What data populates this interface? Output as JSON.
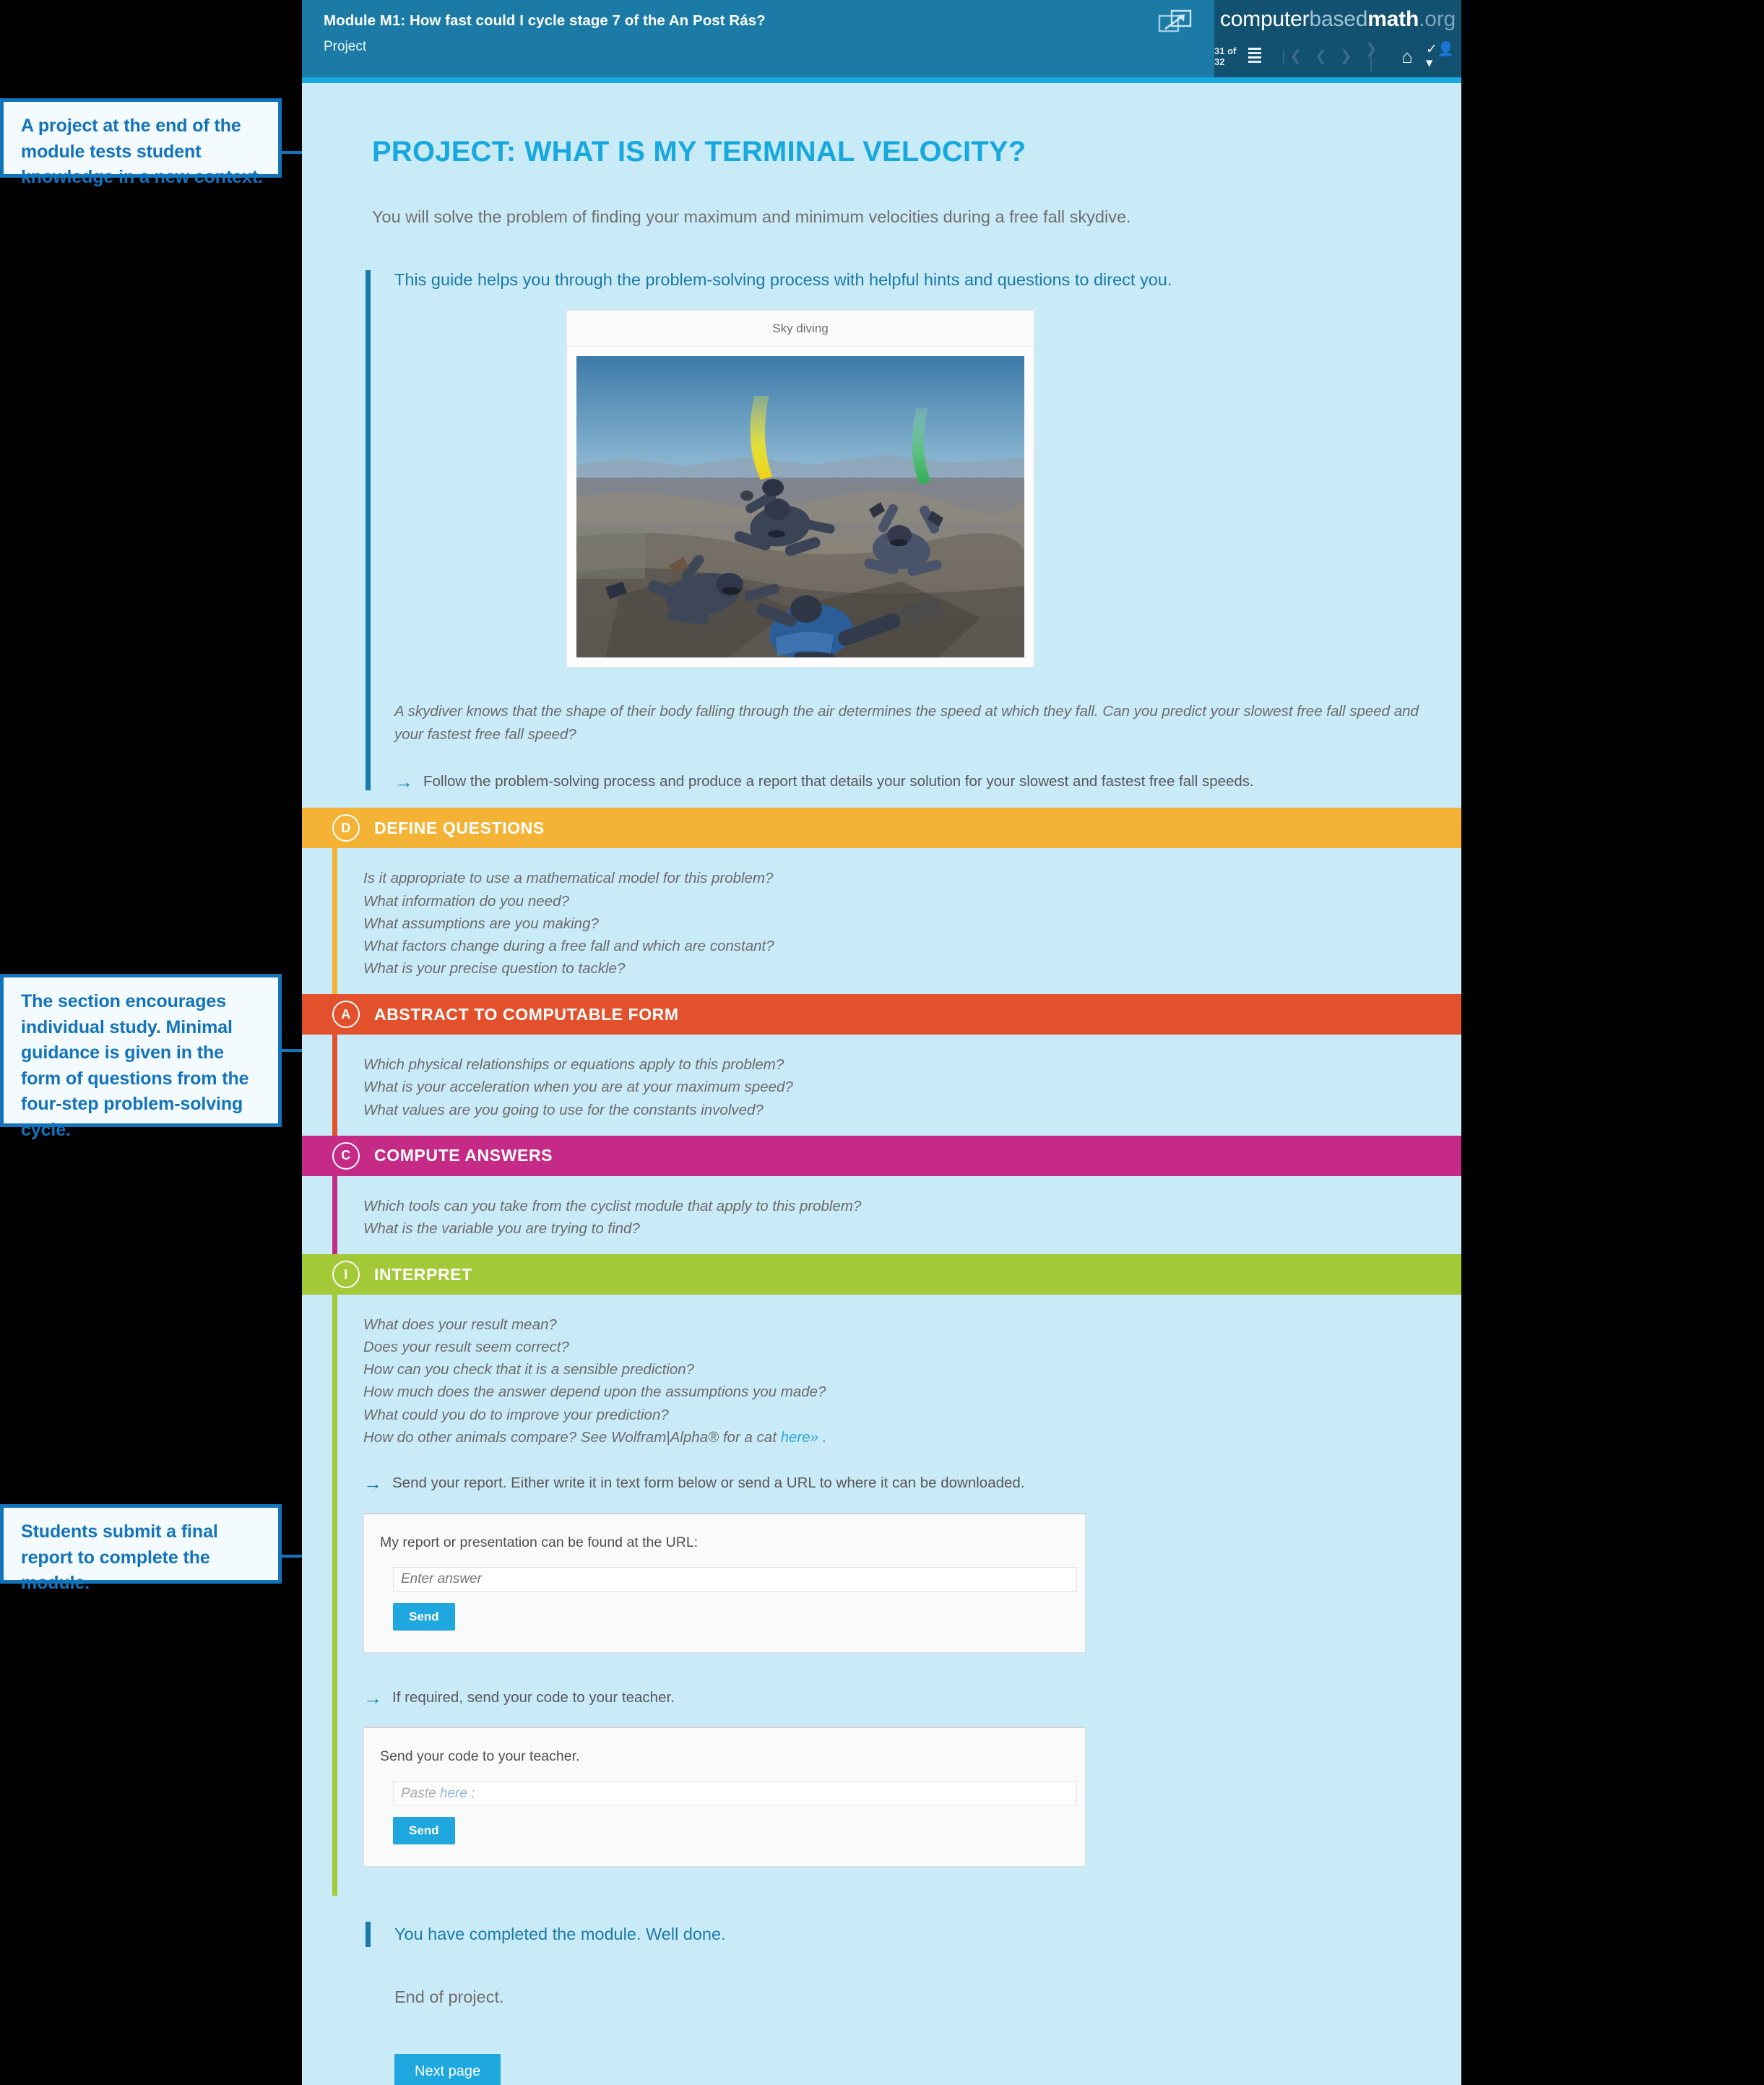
{
  "annotations": [
    {
      "id": "a1",
      "text": "A project at the end of the module tests student knowledge in a new context."
    },
    {
      "id": "a2",
      "text": "The section encourages individual study. Minimal guidance is given in the form of questions from the four-step problem-solving cycle."
    },
    {
      "id": "a3",
      "text": "Students submit a final report to complete the module."
    }
  ],
  "topbar": {
    "title": "Module M1: How fast could I cycle stage 7 of the An Post Rás?",
    "subtitle": "Project",
    "popout_icon": "popout-icon",
    "brand": {
      "part1": "computer",
      "part2": "based",
      "part3": "math",
      "part4": ".org"
    },
    "nav": {
      "page_count": "31 of 32",
      "list_icon": "list-icon",
      "first_icon": "❘❮",
      "prev_icon": "❮",
      "next_icon": "❯",
      "last_icon": "❯❘",
      "home_icon": "⌂",
      "account_icon": "✔👤▾"
    }
  },
  "main": {
    "title": "PROJECT: WHAT IS MY TERMINAL VELOCITY?",
    "intro": "You will solve the problem of finding your maximum and minimum velocities during a free fall skydive.",
    "guide_lead": "This guide helps you through the problem-solving process with helpful hints and questions to direct you.",
    "figure_caption": "Sky diving",
    "italic_note": "A skydiver knows that the shape of their body falling through the air determines the speed at which they fall. Can you predict your slowest free fall speed and your fastest free fall speed?",
    "follow_instruction": "Follow the problem-solving process and produce a report that details your solution for your slowest and fastest free fall speeds.",
    "arrow_glyph": "→"
  },
  "sections": [
    {
      "key": "define",
      "badge": "D",
      "title": "DEFINE QUESTIONS",
      "color": "#f5b335",
      "questions": [
        "Is it appropriate to use a mathematical model for this problem?",
        "What information do you need?",
        "What assumptions are you making?",
        "What factors change during a free fall and which are constant?",
        "What is your precise question to tackle?"
      ]
    },
    {
      "key": "abstract",
      "badge": "A",
      "title": "ABSTRACT TO COMPUTABLE FORM",
      "color": "#e2512b",
      "questions": [
        "Which physical relationships or equations apply to this problem?",
        "What is your acceleration when you are at your maximum speed?",
        "What values are you going to use for the constants involved?"
      ]
    },
    {
      "key": "compute",
      "badge": "C",
      "title": "COMPUTE ANSWERS",
      "color": "#c42a86",
      "questions": [
        "Which tools can you take from the cyclist module that apply to this problem?",
        "What is the variable you are trying to find?"
      ]
    },
    {
      "key": "interpret",
      "badge": "I",
      "title": "INTERPRET",
      "color": "#a3c936",
      "questions": [
        "What does your result mean?",
        "Does your result seem correct?",
        "How can you check that it is a sensible prediction?",
        "How much does the answer depend upon the assumptions you made?",
        "What could you do to improve your prediction?"
      ],
      "last_question_pre": "How do other animals compare? See Wolfram|Alpha® for a cat ",
      "last_question_link": "here»",
      "last_question_post": " ."
    }
  ],
  "report": {
    "instruction": "Send your report. Either write it in text form below or send a URL to where it can be downloaded.",
    "label": "My report or presentation can be found at the URL:",
    "placeholder": "Enter answer",
    "send_label": "Send"
  },
  "code": {
    "instruction": "If required, send your code to your teacher.",
    "label": "Send your code to your teacher.",
    "placeholder_pre": "Paste ",
    "placeholder_link": "here",
    "placeholder_post": " :",
    "send_label": "Send"
  },
  "footer": {
    "completed": "You have completed the module. Well done.",
    "end": "End of project.",
    "next_label": "Next page"
  }
}
